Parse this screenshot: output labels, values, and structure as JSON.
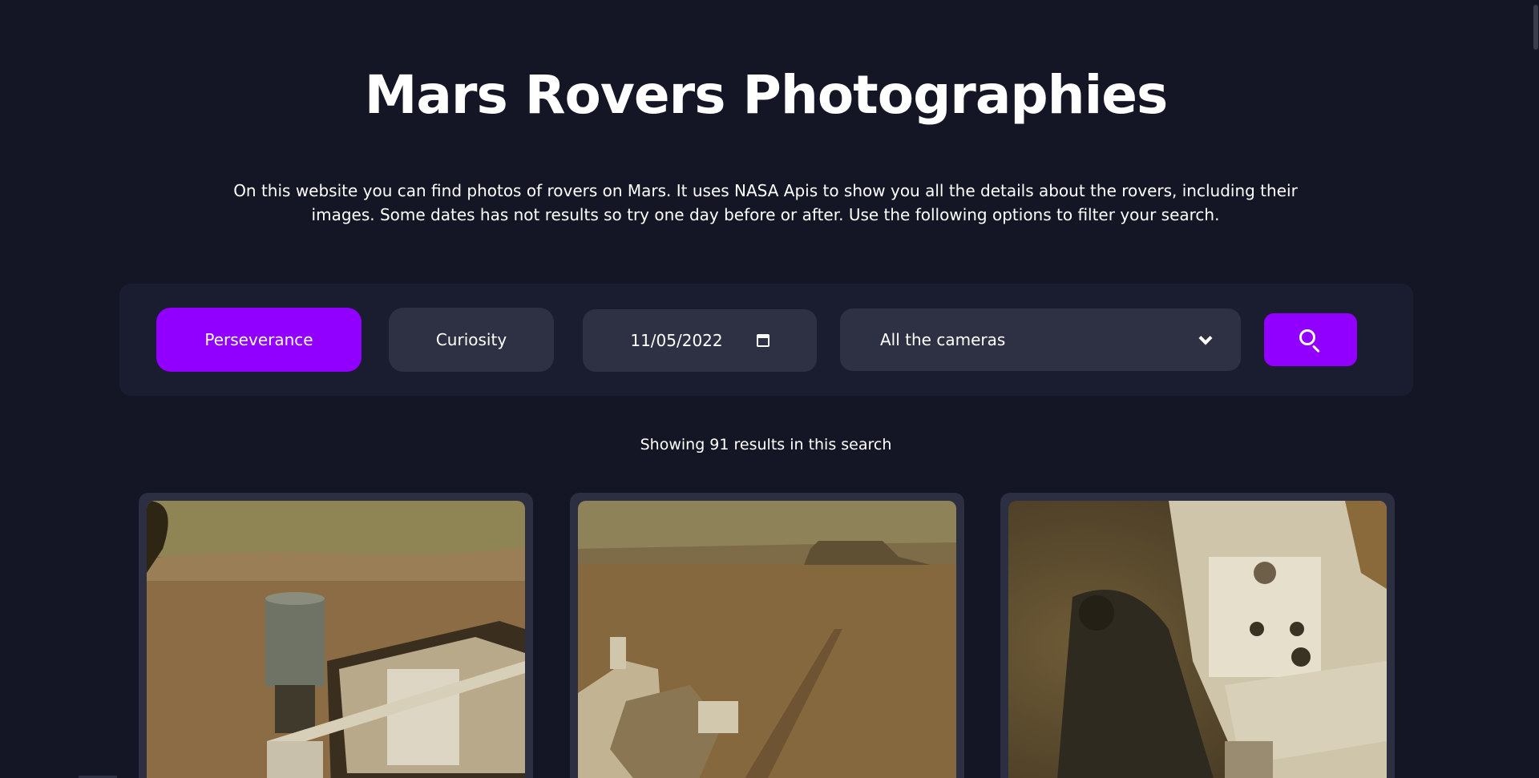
{
  "header": {
    "title": "Mars Rovers Photographies",
    "description": "On this website you can find photos of rovers on Mars. It uses NASA Apis to show you all the details about the rovers, including their images. Some dates has not results so try one day before or after. Use the following options to filter your search."
  },
  "filters": {
    "rovers": [
      {
        "label": "Perseverance",
        "active": true
      },
      {
        "label": "Curiosity",
        "active": false
      }
    ],
    "date": "11/05/2022",
    "camera_select": {
      "selected": "All the cameras"
    },
    "search_icon": "search-icon"
  },
  "results": {
    "summary": "Showing 91 results in this search",
    "count": 91
  },
  "colors": {
    "background": "#141625",
    "panel": "#1a1c30",
    "control": "#2e3043",
    "accent": "#9100ff",
    "card": "#2c2e41"
  },
  "photos": [
    {
      "subject": "rover-mast-and-deck"
    },
    {
      "subject": "terrain-with-mesa"
    },
    {
      "subject": "rover-wheel-and-deck"
    }
  ]
}
